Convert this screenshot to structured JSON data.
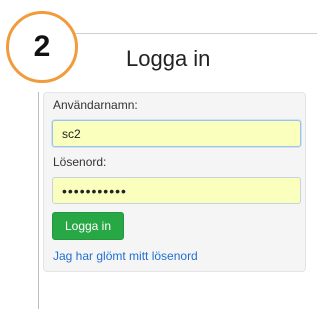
{
  "step": {
    "number": "2",
    "accent_color": "#f29b3c"
  },
  "login": {
    "title": "Logga in",
    "username_label": "Användarnamn:",
    "username_value": "sc2",
    "password_label": "Lösenord:",
    "password_value": "•••••••••••",
    "submit_label": "Logga in",
    "forgot_password_link": "Jag har glömt mitt lösenord",
    "autofill_color": "#faffbd",
    "button_color": "#28a745",
    "link_color": "#1f6fd1"
  }
}
